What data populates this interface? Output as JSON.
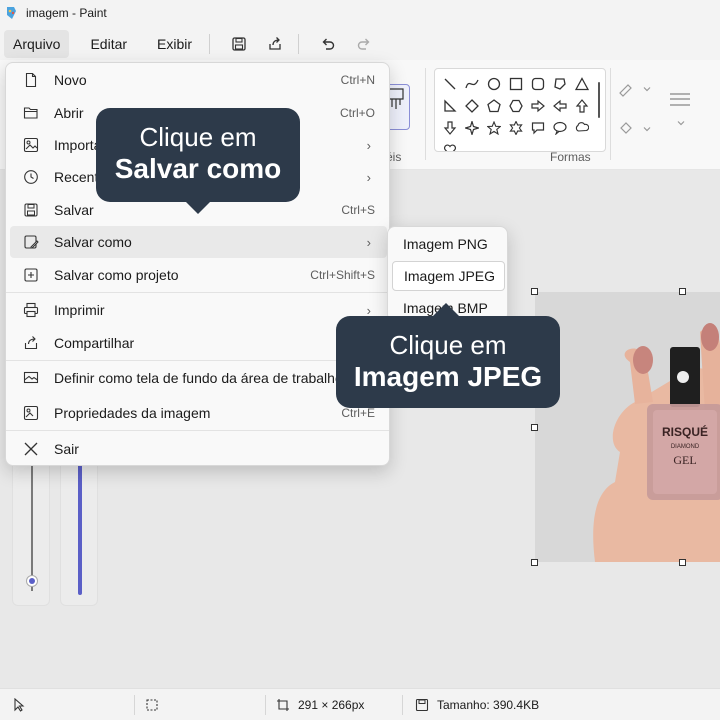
{
  "window": {
    "title": "imagem - Paint"
  },
  "menubar": {
    "file": "Arquivo",
    "edit": "Editar",
    "view": "Exibir"
  },
  "ribbon": {
    "shapes_label": "Formas",
    "brushes_label_partial": "céis"
  },
  "file_menu": {
    "items": [
      {
        "label": "Novo",
        "shortcut": "Ctrl+N",
        "icon": "new-file-icon"
      },
      {
        "label": "Abrir",
        "shortcut": "Ctrl+O",
        "icon": "folder-open-icon"
      },
      {
        "label": "Importar",
        "icon": "import-icon",
        "submenu": true
      },
      {
        "label": "Recentes",
        "icon": "recent-icon",
        "submenu": true
      },
      {
        "label": "Salvar",
        "shortcut": "Ctrl+S",
        "icon": "save-icon"
      },
      {
        "label": "Salvar como",
        "icon": "save-as-icon",
        "submenu": true
      },
      {
        "label": "Salvar como projeto",
        "shortcut": "Ctrl+Shift+S",
        "icon": "save-project-icon"
      },
      {
        "label": "Imprimir",
        "icon": "printer-icon",
        "submenu": true
      },
      {
        "label": "Compartilhar",
        "icon": "share-icon"
      },
      {
        "label": "Definir como tela de fundo da área de trabalho",
        "icon": "wallpaper-icon",
        "submenu": true
      },
      {
        "label": "Propriedades da imagem",
        "shortcut": "Ctrl+E",
        "icon": "image-properties-icon"
      },
      {
        "label": "Sair",
        "icon": "close-icon"
      }
    ]
  },
  "save_as_submenu": {
    "items": [
      {
        "label": "Imagem PNG"
      },
      {
        "label": "Imagem JPEG"
      },
      {
        "label": "Imagem BMP"
      }
    ]
  },
  "callouts": {
    "first": {
      "line1": "Clique em",
      "line2": "Salvar como"
    },
    "second": {
      "line1": "Clique em",
      "line2": "Imagem JPEG"
    }
  },
  "canvas": {
    "bottle_brand": "RISQUÉ",
    "bottle_sub": "DIAMOND",
    "bottle_gel": "GEL"
  },
  "statusbar": {
    "dimensions": "291 × 266px",
    "size": "Tamanho: 390.4KB"
  },
  "colors": {
    "callout_bg": "#2d3a4a",
    "accent": "#5b5fc7"
  }
}
